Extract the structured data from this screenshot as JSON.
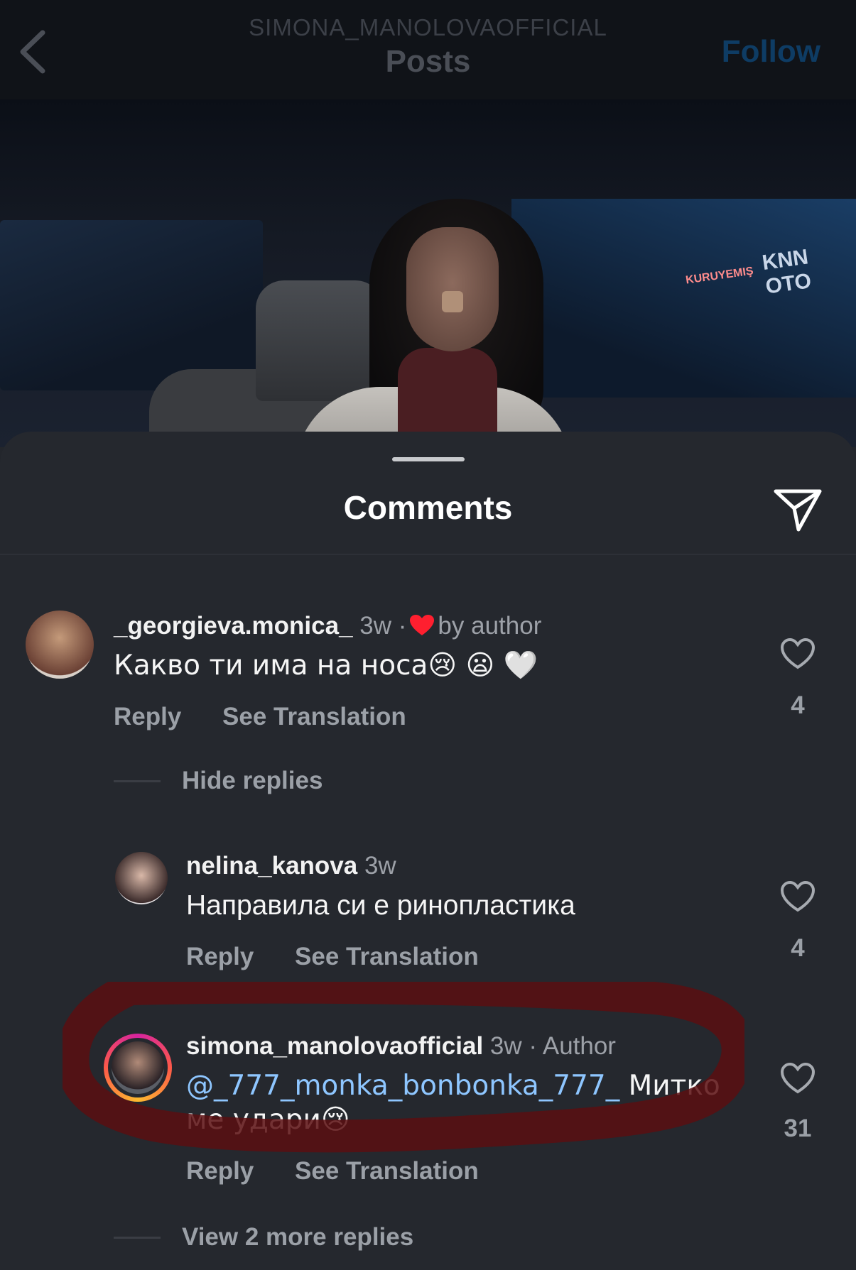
{
  "header": {
    "username": "SIMONA_MANOLOVAOFFICIAL",
    "title": "Posts",
    "follow_label": "Follow"
  },
  "photo": {
    "sign_text": "KNN OTO",
    "sign_text2": "KURUYEMIŞ"
  },
  "sheet": {
    "title": "Comments"
  },
  "comments": [
    {
      "username": "_georgieva.monica_",
      "time": "3w",
      "liked_by_author": "by author",
      "text": "Какво ти има на носа😢 😦 🤍",
      "reply_label": "Reply",
      "translate_label": "See Translation",
      "likes": "4",
      "thread_label": "Hide replies"
    },
    {
      "username": "nelina_kanova",
      "time": "3w",
      "text": "Направила си е ринопластика",
      "reply_label": "Reply",
      "translate_label": "See Translation",
      "likes": "4"
    },
    {
      "username": "simona_manolovaofficial",
      "time": "3w",
      "badge": "Author",
      "mention": "@_777_monka_bonbonka_777_",
      "text_line1": " Митко",
      "text_line2": "ме удари😢",
      "reply_label": "Reply",
      "translate_label": "See Translation",
      "likes": "31",
      "thread_label": "View 2 more replies"
    }
  ],
  "colors": {
    "background": "#23262c",
    "follow": "#0e3c64",
    "mention": "#8ec6ff",
    "highlight": "#5a0e10"
  }
}
